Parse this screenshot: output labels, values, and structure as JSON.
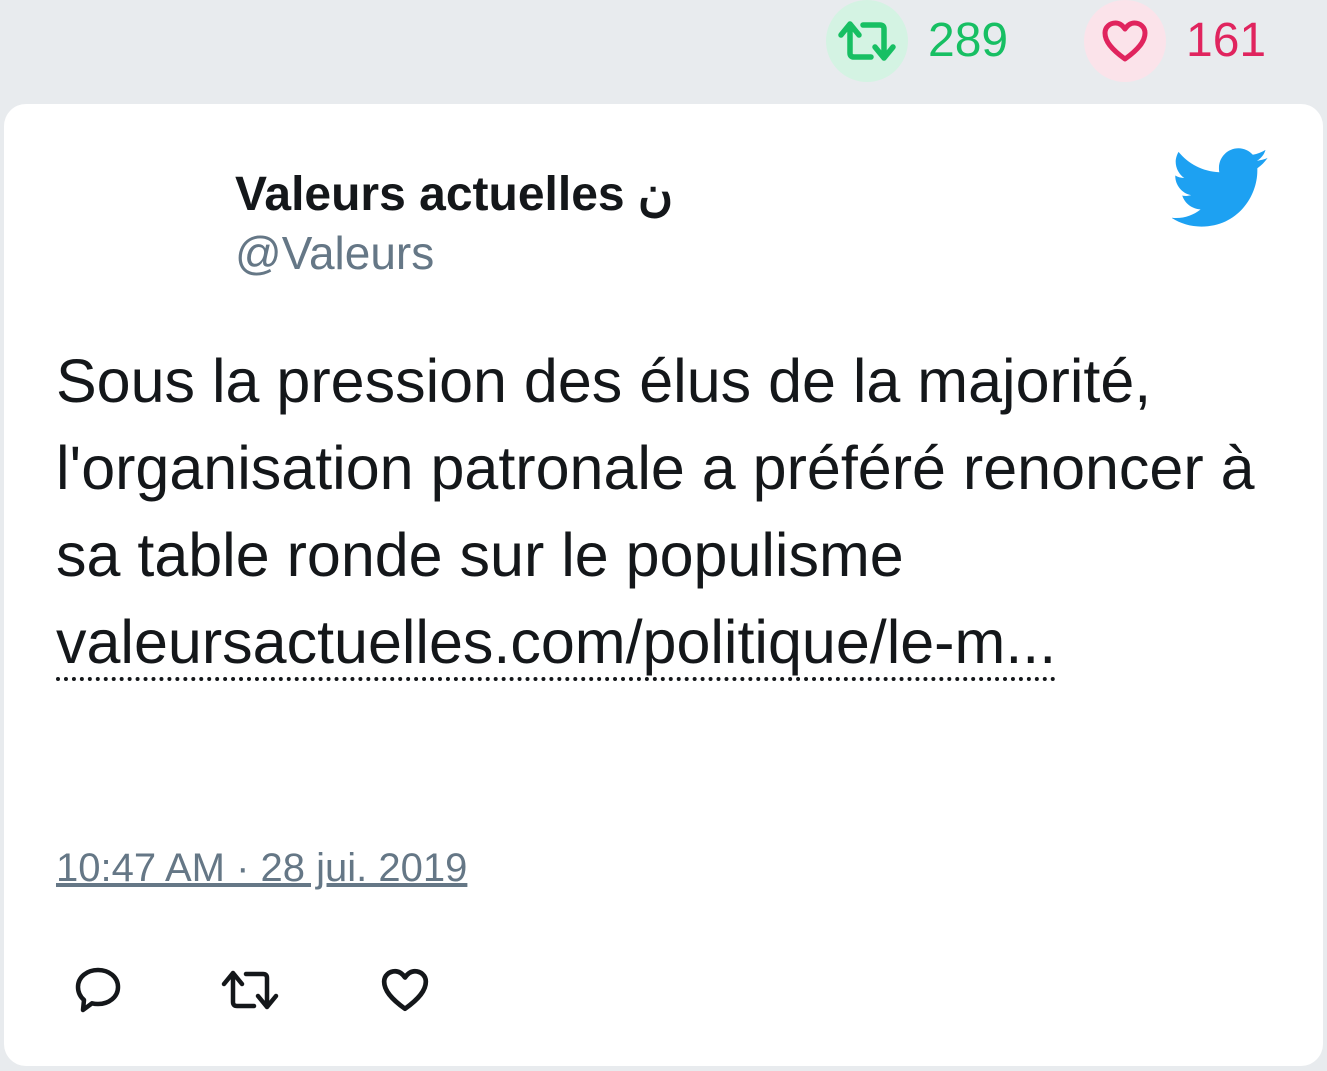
{
  "top_stats": {
    "retweet_count": "289",
    "like_count": "161",
    "retweet_icon": "retweet-icon",
    "like_icon": "heart-icon"
  },
  "tweet": {
    "user_name": "Valeurs actuelles ن",
    "handle": "@Valeurs",
    "text": "Sous la pression des élus de la majorité, l'organisation patronale a préféré renoncer à sa table ronde sur le populisme",
    "link_text": "valeursactuelles.com/politique/le-m...",
    "timestamp": "10:47 AM · 28 jui. 2019",
    "brand_icon": "twitter-bird-icon"
  },
  "actions": {
    "reply_icon": "reply-icon",
    "retweet_icon": "retweet-icon",
    "like_icon": "heart-icon"
  },
  "colors": {
    "retweet_green": "#17bf63",
    "like_red": "#e0245e",
    "twitter_blue": "#1da1f2",
    "text_dark": "#14171a",
    "text_gray": "#657786",
    "background": "#e8ebee"
  }
}
